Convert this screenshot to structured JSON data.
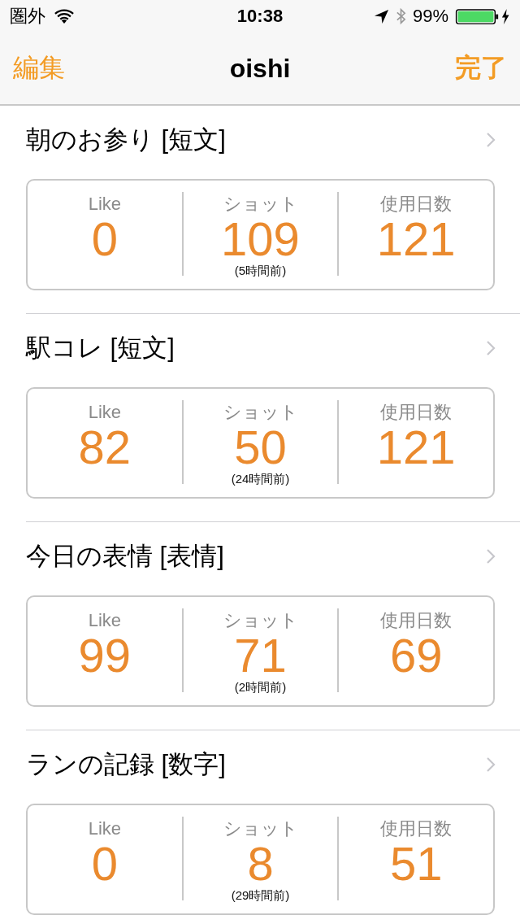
{
  "status_bar": {
    "carrier": "圏外",
    "time": "10:38",
    "battery": "99%"
  },
  "nav": {
    "left": "編集",
    "title": "oishi",
    "right": "完了"
  },
  "sections": [
    {
      "title": "朝のお参り [短文]",
      "stats": [
        {
          "label": "Like",
          "value": "0"
        },
        {
          "label": "ショット",
          "value": "109",
          "note": "(5時間前)"
        },
        {
          "label": "使用日数",
          "value": "121"
        }
      ]
    },
    {
      "title": "駅コレ [短文]",
      "stats": [
        {
          "label": "Like",
          "value": "82"
        },
        {
          "label": "ショット",
          "value": "50",
          "note": "(24時間前)"
        },
        {
          "label": "使用日数",
          "value": "121"
        }
      ]
    },
    {
      "title": "今日の表情 [表情]",
      "stats": [
        {
          "label": "Like",
          "value": "99"
        },
        {
          "label": "ショット",
          "value": "71",
          "note": "(2時間前)"
        },
        {
          "label": "使用日数",
          "value": "69"
        }
      ]
    },
    {
      "title": "ランの記録 [数字]",
      "stats": [
        {
          "label": "Like",
          "value": "0"
        },
        {
          "label": "ショット",
          "value": "8",
          "note": "(29時間前)"
        },
        {
          "label": "使用日数",
          "value": "51"
        }
      ]
    }
  ]
}
